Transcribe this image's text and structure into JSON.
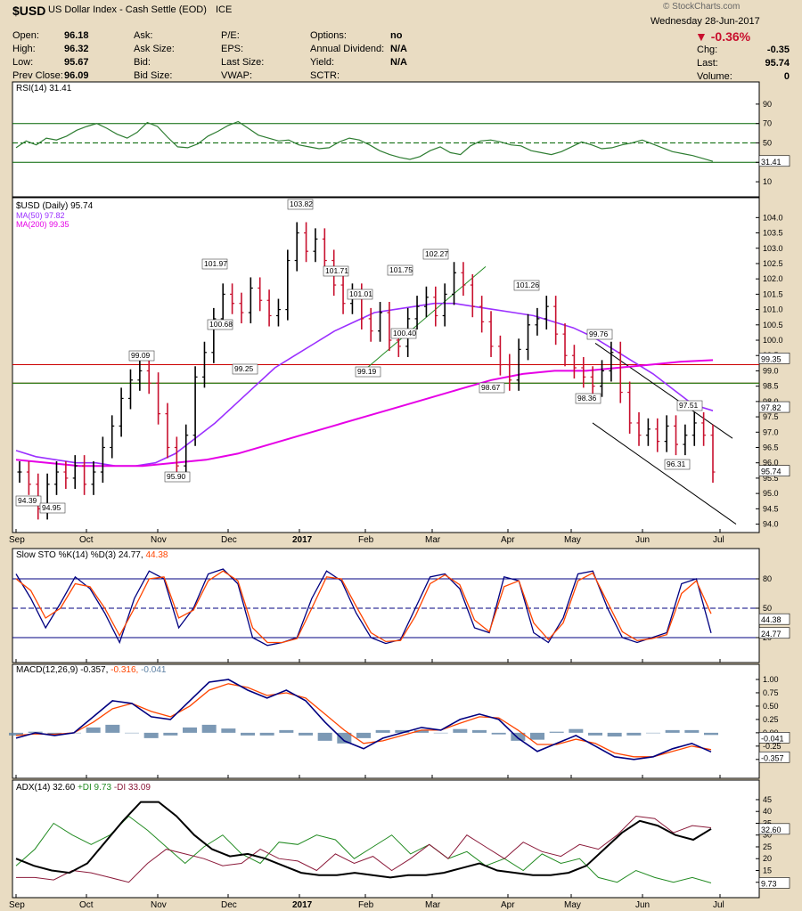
{
  "header": {
    "symbol": "$USD",
    "name": "US Dollar Index - Cash Settle (EOD)",
    "exchange": "ICE",
    "watermark": "© StockCharts.com",
    "date": "Wednesday   28-Jun-2017",
    "change_pct": "▼ -0.36%",
    "rows": [
      [
        {
          "label": "Open:",
          "value": "96.18"
        },
        {
          "label": "Ask:",
          "value": ""
        },
        {
          "label": "P/E:",
          "value": ""
        },
        {
          "label": "Options:",
          "value": "no"
        }
      ],
      [
        {
          "label": "High:",
          "value": "96.32"
        },
        {
          "label": "Ask Size:",
          "value": ""
        },
        {
          "label": "EPS:",
          "value": ""
        },
        {
          "label": "Annual Dividend:",
          "value": "N/A"
        }
      ],
      [
        {
          "label": "Low:",
          "value": "95.67"
        },
        {
          "label": "Bid:",
          "value": ""
        },
        {
          "label": "Last Size:",
          "value": ""
        },
        {
          "label": "Yield:",
          "value": "N/A"
        }
      ],
      [
        {
          "label": "Prev Close:",
          "value": "96.09"
        },
        {
          "label": "Bid Size:",
          "value": ""
        },
        {
          "label": "VWAP:",
          "value": ""
        },
        {
          "label": "SCTR:",
          "value": ""
        }
      ]
    ],
    "right_rows": [
      {
        "label": "Chg:",
        "value": "-0.35"
      },
      {
        "label": "Last:",
        "value": "95.74"
      },
      {
        "label": "Volume:",
        "value": "0"
      }
    ]
  },
  "chart_data": [
    {
      "type": "line",
      "panel": "rsi",
      "title": "RSI(14) 31.41",
      "last_value": "31.41",
      "ylim": [
        0,
        100
      ],
      "yticks": [
        "90",
        "70",
        "50",
        "30",
        "10"
      ],
      "reference_lines": [
        70,
        50,
        30
      ],
      "values": [
        45,
        52,
        48,
        55,
        53,
        57,
        63,
        67,
        70,
        65,
        59,
        55,
        61,
        71,
        67,
        56,
        46,
        45,
        49,
        57,
        62,
        68,
        72,
        65,
        58,
        55,
        52,
        53,
        48,
        46,
        44,
        45,
        51,
        55,
        53,
        48,
        42,
        38,
        35,
        33,
        36,
        42,
        46,
        40,
        38,
        47,
        52,
        53,
        51,
        48,
        47,
        42,
        40,
        38,
        41,
        46,
        51,
        48,
        44,
        45,
        48,
        50,
        53,
        49,
        45,
        41,
        39,
        37,
        34,
        31
      ]
    },
    {
      "type": "ohlc",
      "panel": "price",
      "title": "$USD (Daily) 95.74",
      "x_labels": [
        "Sep",
        "Oct",
        "Nov",
        "Dec",
        "2017",
        "Feb",
        "Mar",
        "Apr",
        "May",
        "Jun",
        "Jul"
      ],
      "yticks": [
        "104.0",
        "103.5",
        "103.0",
        "102.5",
        "102.0",
        "101.5",
        "101.0",
        "100.5",
        "100.0",
        "99.5",
        "99.0",
        "98.5",
        "98.0",
        "97.5",
        "97.0",
        "96.5",
        "96.0",
        "95.5",
        "95.0",
        "94.5",
        "94.0"
      ],
      "ylim": [
        93.9,
        104.3
      ],
      "last_value": "95.74",
      "series": [
        {
          "name": "MA(50) 97.82",
          "color": "#9b30ff",
          "right_label": "97.82"
        },
        {
          "name": "MA(200) 99.35",
          "color": "#e600e6",
          "right_label": "99.35"
        }
      ],
      "close": [
        95.7,
        95.3,
        94.5,
        95.3,
        95.7,
        95.5,
        95.9,
        95.3,
        95.7,
        96.5,
        97.2,
        98.1,
        98.7,
        99.0,
        98.6,
        97.6,
        96.5,
        95.9,
        96.9,
        98.8,
        99.6,
        100.7,
        101.5,
        101.2,
        100.9,
        101.7,
        101.3,
        100.8,
        101.0,
        102.6,
        103.5,
        102.9,
        103.3,
        102.6,
        101.8,
        101.2,
        101.5,
        100.7,
        100.3,
        100.9,
        100.0,
        99.8,
        100.7,
        101.1,
        101.4,
        100.8,
        101.5,
        102.2,
        101.8,
        101.1,
        100.6,
        99.8,
        99.2,
        98.7,
        99.7,
        100.5,
        100.7,
        101.1,
        100.2,
        99.5,
        99.1,
        98.8,
        98.5,
        99.0,
        99.6,
        98.3,
        97.3,
        96.9,
        97.1,
        96.7,
        97.2,
        96.6,
        96.9,
        97.3,
        96.9,
        95.7
      ],
      "ma50": [
        96.4,
        96.2,
        96.1,
        96.0,
        96.0,
        95.9,
        95.9,
        96.0,
        96.3,
        96.8,
        97.3,
        97.9,
        98.5,
        99.1,
        99.5,
        99.9,
        100.3,
        100.6,
        100.9,
        101.0,
        101.1,
        101.2,
        101.2,
        101.1,
        101.0,
        100.9,
        100.8,
        100.6,
        100.4,
        100.1,
        99.7,
        99.3,
        98.9,
        98.4,
        97.9,
        97.7
      ],
      "ma200": [
        96.1,
        96.0,
        95.9,
        95.9,
        95.9,
        96.0,
        96.1,
        96.3,
        96.6,
        96.9,
        97.2,
        97.5,
        97.8,
        98.1,
        98.4,
        98.7,
        98.9,
        99.0,
        99.0,
        99.1,
        99.2,
        99.3,
        99.35
      ],
      "reference_lines": [
        {
          "value": 99.2,
          "color": "#cc0000"
        },
        {
          "value": 98.6,
          "color": "#cc0000"
        },
        {
          "value": 98.6,
          "color": "#008000"
        }
      ],
      "annotations": [
        "94.39",
        "94.95",
        "99.09",
        "95.90",
        "101.97",
        "100.68",
        "99.25",
        "103.82",
        "101.71",
        "101.01",
        "99.19",
        "101.75",
        "100.40",
        "102.27",
        "98.67",
        "101.26",
        "99.76",
        "98.36",
        "97.51",
        "96.31"
      ]
    },
    {
      "type": "line",
      "panel": "stochastic",
      "title": "Slow STO %K(14) %D(3) 24.77,",
      "title_d": "44.38",
      "yticks": [
        "80",
        "50",
        "20"
      ],
      "ylim": [
        0,
        100
      ],
      "reference_lines": [
        80,
        50,
        20
      ],
      "right_labels": [
        "44.38",
        "24.77"
      ],
      "series": [
        {
          "name": "%K",
          "color": "#000080",
          "values": [
            85,
            60,
            30,
            55,
            82,
            70,
            45,
            15,
            60,
            88,
            80,
            30,
            50,
            85,
            90,
            75,
            20,
            12,
            15,
            20,
            60,
            88,
            78,
            45,
            20,
            14,
            18,
            50,
            82,
            85,
            70,
            30,
            25,
            82,
            78,
            25,
            15,
            40,
            85,
            88,
            50,
            20,
            15,
            20,
            25,
            75,
            80,
            24.77
          ]
        },
        {
          "name": "%D",
          "color": "#ff4500",
          "values": [
            80,
            68,
            40,
            50,
            75,
            72,
            50,
            22,
            50,
            80,
            82,
            40,
            48,
            78,
            88,
            78,
            30,
            15,
            15,
            19,
            50,
            82,
            80,
            52,
            25,
            16,
            17,
            42,
            75,
            84,
            74,
            38,
            26,
            72,
            78,
            35,
            18,
            35,
            78,
            86,
            56,
            26,
            17,
            19,
            23,
            65,
            78,
            44.38
          ]
        }
      ]
    },
    {
      "type": "line",
      "panel": "macd",
      "title": "MACD(12,26,9) -0.357,",
      "title_signal": "-0.316,",
      "title_hist": "-0.041",
      "yticks": [
        "1.00",
        "0.75",
        "0.50",
        "0.25",
        "0.00",
        "-0.25",
        "-0.50"
      ],
      "ylim": [
        -0.62,
        1.1
      ],
      "right_labels": [
        "-0.041",
        "-0.357"
      ],
      "series": [
        {
          "name": "MACD",
          "color": "#000080",
          "values": [
            -0.1,
            0.0,
            -0.05,
            0.0,
            0.3,
            0.6,
            0.55,
            0.3,
            0.25,
            0.6,
            0.95,
            1.0,
            0.8,
            0.65,
            0.8,
            0.6,
            0.2,
            -0.15,
            -0.3,
            -0.1,
            0.0,
            0.1,
            0.05,
            0.25,
            0.35,
            0.25,
            -0.1,
            -0.35,
            -0.2,
            -0.05,
            -0.25,
            -0.45,
            -0.5,
            -0.45,
            -0.3,
            -0.2,
            -0.357
          ]
        },
        {
          "name": "Signal",
          "color": "#ff4500",
          "values": [
            -0.05,
            -0.02,
            -0.03,
            0.0,
            0.2,
            0.45,
            0.55,
            0.4,
            0.3,
            0.5,
            0.8,
            0.92,
            0.85,
            0.7,
            0.75,
            0.65,
            0.35,
            0.05,
            -0.2,
            -0.15,
            -0.05,
            0.05,
            0.05,
            0.18,
            0.3,
            0.28,
            0.05,
            -0.22,
            -0.22,
            -0.12,
            -0.2,
            -0.38,
            -0.45,
            -0.45,
            -0.35,
            -0.25,
            -0.316
          ]
        },
        {
          "name": "Histogram",
          "color": "#5b7fa3",
          "values": [
            -0.05,
            0.02,
            -0.02,
            0.0,
            0.1,
            0.15,
            0.0,
            -0.1,
            -0.05,
            0.1,
            0.15,
            0.08,
            -0.05,
            -0.05,
            0.05,
            -0.05,
            -0.15,
            -0.2,
            -0.1,
            0.05,
            0.05,
            0.05,
            0.0,
            0.07,
            0.05,
            -0.03,
            -0.15,
            -0.13,
            0.02,
            0.07,
            -0.05,
            -0.07,
            -0.05,
            0.0,
            0.05,
            0.05,
            -0.041
          ]
        }
      ]
    },
    {
      "type": "line",
      "panel": "adx",
      "title": "ADX(14) 32.60",
      "title_plus": "+DI 9.73",
      "title_minus": "-DI 33.09",
      "yticks": [
        "45",
        "40",
        "35",
        "30",
        "25",
        "20",
        "15",
        "10"
      ],
      "ylim": [
        5,
        48
      ],
      "right_labels": [
        "32.60",
        "9.73"
      ],
      "series": [
        {
          "name": "ADX",
          "color": "#000000",
          "values": [
            20,
            17,
            15,
            14,
            18,
            27,
            36,
            44,
            44,
            38,
            30,
            24,
            21,
            22,
            20,
            17,
            14,
            13,
            13,
            14,
            13,
            12,
            13,
            13,
            14,
            16,
            18,
            15,
            14,
            13,
            13,
            14,
            17,
            24,
            31,
            36,
            34,
            30,
            28,
            32.6
          ]
        },
        {
          "name": "+DI",
          "color": "#228b22",
          "values": [
            17,
            24,
            35,
            30,
            26,
            30,
            38,
            32,
            25,
            18,
            25,
            30,
            22,
            18,
            27,
            26,
            30,
            28,
            20,
            25,
            30,
            22,
            26,
            20,
            23,
            17,
            20,
            15,
            22,
            18,
            20,
            12,
            10,
            15,
            12,
            10,
            12,
            9.73
          ]
        },
        {
          "name": "-DI",
          "color": "#8b1a3a",
          "values": [
            12,
            12,
            11,
            15,
            14,
            12,
            10,
            18,
            24,
            22,
            20,
            17,
            18,
            24,
            20,
            19,
            15,
            22,
            18,
            21,
            15,
            20,
            26,
            20,
            30,
            25,
            20,
            27,
            23,
            21,
            26,
            24,
            30,
            38,
            37,
            31,
            34,
            33.09
          ]
        }
      ]
    }
  ],
  "colors": {
    "background": "#e9dcc2",
    "panel": "#ffffff",
    "up_bar": "#000000",
    "down_bar": "#c8102e"
  }
}
